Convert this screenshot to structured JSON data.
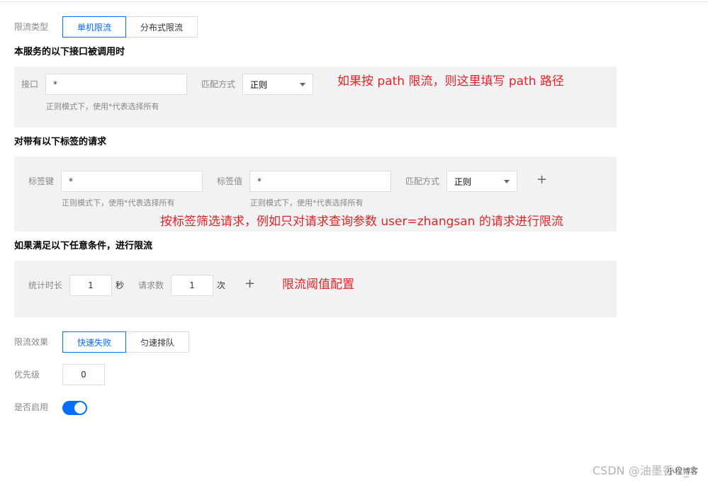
{
  "limit_type": {
    "label": "限流类型",
    "options": [
      "单机限流",
      "分布式限流"
    ],
    "selected": "单机限流"
  },
  "section_api": {
    "title": "本服务的以下接口被调用时",
    "api_label": "接口",
    "api_value": "*",
    "match_label": "匹配方式",
    "match_value": "正则",
    "hint": "正则模式下，使用*代表选择所有",
    "annotation": "如果按 path 限流，则这里填写 path 路径"
  },
  "section_tags": {
    "title": "对带有以下标签的请求",
    "key_label": "标签键",
    "key_value": "*",
    "key_hint": "正则模式下，使用*代表选择所有",
    "value_label": "标签值",
    "value_value": "*",
    "value_hint": "正则模式下，使用*代表选择所有",
    "match_label": "匹配方式",
    "match_value": "正则",
    "add_symbol": "+",
    "annotation": "按标签筛选请求，例如只对请求查询参数 user=zhangsan 的请求进行限流"
  },
  "section_condition": {
    "title": "如果满足以下任意条件，进行限流",
    "duration_label": "统计时长",
    "duration_value": "1",
    "duration_unit": "秒",
    "count_label": "请求数",
    "count_value": "1",
    "count_unit": "次",
    "add_symbol": "+",
    "annotation": "限流阈值配置"
  },
  "effect": {
    "label": "限流效果",
    "options": [
      "快速失败",
      "匀速排队"
    ],
    "selected": "快速失败"
  },
  "priority": {
    "label": "优先级",
    "value": "0"
  },
  "enabled": {
    "label": "是否启用",
    "on": true,
    "accent": "#006eff"
  },
  "watermark": {
    "text": "CSDN @油墨香^_^",
    "small": "小程博客"
  }
}
